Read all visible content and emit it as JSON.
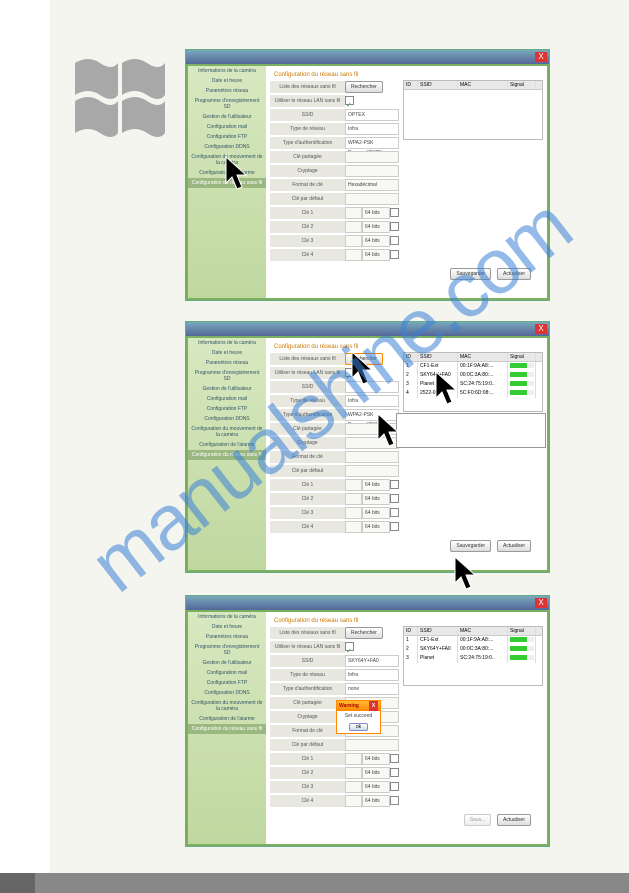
{
  "watermark": "manualshine.com",
  "common": {
    "close_x": "X",
    "search_btn": "Rechercher",
    "save_btn": "Sauvegarder",
    "refresh_btn": "Actualiser",
    "save_btn_disabled": "Sauv..."
  },
  "sidebar": {
    "items": [
      "Informations de la caméra",
      "Date et heure",
      "Paramètres réseau",
      "Programme d'enregistrement SD",
      "Gestion de l'utilisateur",
      "Configuration mail",
      "Configuration FTP",
      "Configuration DDNS",
      "Configuration du mouvement de la caméra",
      "Configuration de l'alarme",
      "Configuration du réseau sans fil"
    ],
    "selected_index": 10
  },
  "form": {
    "group_title": "Configuration du réseau sans fil",
    "list_label": "Liste des réseaux sans fil",
    "use_wlan": "Utiliser le réseau LAN sans fil",
    "ssid": "SSID",
    "net_type": "Type de réseau",
    "auth_type": "Type d'authentification",
    "shared_key": "Clé partagée",
    "crypt": "Cryptage",
    "key_fmt": "Format de clé",
    "def_key": "Clé par défaut",
    "key1": "Clé 1",
    "key2": "Clé 2",
    "key3": "Clé 3",
    "key4": "Clé 4",
    "bits64": "64 bits",
    "net_type_val": "Infra",
    "auth_val": "WPA2-PSK Personal(TKIP)",
    "auth_val_none": "none",
    "ssid_val1": "OPTEX",
    "ssid_val2": "SKY64Y+FA0",
    "key_fmt_val": "Hexadécimal"
  },
  "netlist": {
    "headers": {
      "id": "ID",
      "ssid": "SSID",
      "mac": "MAC",
      "signal": "Signal"
    },
    "rows_d2": [
      {
        "id": "1",
        "ssid": "CF1-Ext",
        "mac": "00:1F:9A:A8:..."
      },
      {
        "id": "2",
        "ssid": "SKY64Y+FA0",
        "mac": "00:0C:3A:80:..."
      },
      {
        "id": "3",
        "ssid": "Planet",
        "mac": "SC:24:75:19:0.."
      },
      {
        "id": "4",
        "ssid": "2522-0004",
        "mac": "5C:F0:6D:08:..."
      }
    ],
    "rows_d3": [
      {
        "id": "1",
        "ssid": "CF1-Ext",
        "mac": "00:1F:9A:A8:..."
      },
      {
        "id": "2",
        "ssid": "SKY64Y+FA0",
        "mac": "00:0C:3A:80:..."
      },
      {
        "id": "3",
        "ssid": "Planet",
        "mac": "SC:24:75:19:0.."
      }
    ]
  },
  "warning": {
    "title": "Warning",
    "msg": "Set succeed",
    "ok": "ok"
  }
}
